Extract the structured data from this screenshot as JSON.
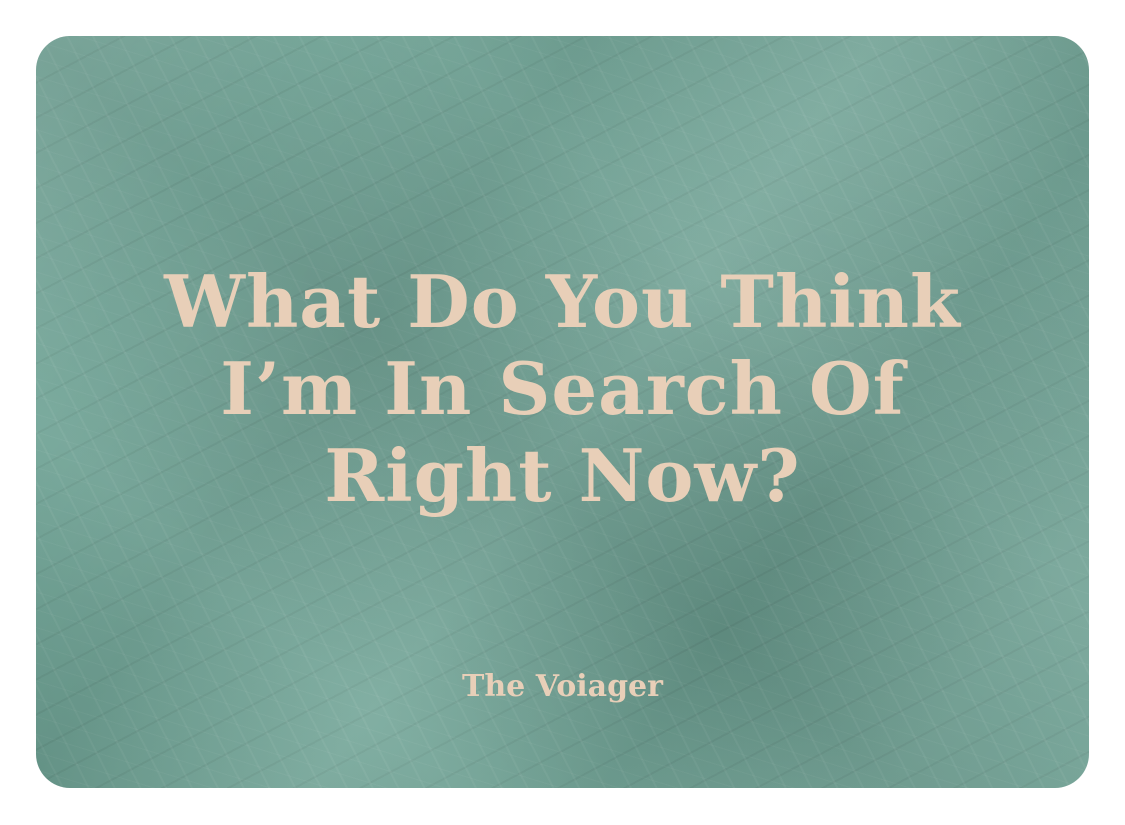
{
  "card": {
    "background_color": "#6fa395",
    "text_color": "#e8cfb8",
    "headline_lines": [
      "What Do You Think",
      "I’m In Search Of",
      "Right Now?"
    ],
    "byline": "The Voiager"
  }
}
